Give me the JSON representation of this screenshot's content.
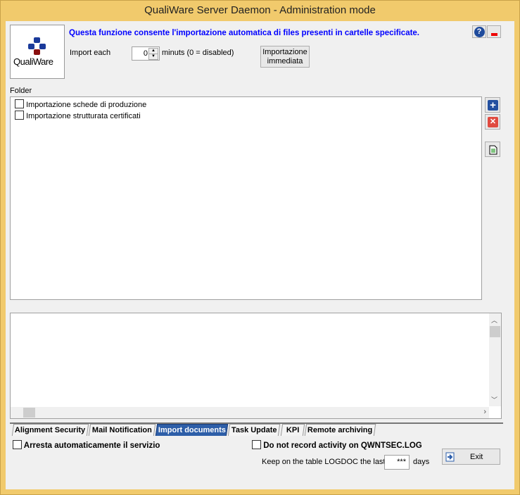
{
  "window": {
    "title": "QualiWare Server Daemon - Administration mode",
    "border_color": "#f0c86a"
  },
  "header": {
    "logo_text": "QualiWare",
    "description": "Questa funzione consente l'importazione automatica di files presenti in cartelle specificate.",
    "description_color": "#0000ff",
    "help_icon": "help-icon",
    "minimize_icon": "minimize-icon"
  },
  "import": {
    "label": "Import each",
    "value": "0",
    "unit_label": "minuts (0 = disabled)",
    "now_button_line1": "Importazione",
    "now_button_line2": "immediata"
  },
  "folder": {
    "label": "Folder",
    "items": [
      {
        "label": "Importazione schede di produzione",
        "checked": false
      },
      {
        "label": "Importazione strutturata certificati",
        "checked": false
      }
    ]
  },
  "side_buttons": {
    "add": "plus-icon",
    "remove": "close-icon",
    "details": "document-icon"
  },
  "tabs": [
    {
      "label": "Alignment Security"
    },
    {
      "label": "Mail Notification"
    },
    {
      "label": "Import documents",
      "selected": true
    },
    {
      "label": "Task Update"
    },
    {
      "label": "KPI"
    },
    {
      "label": "Remote archiving"
    }
  ],
  "footer": {
    "auto_stop_label": "Arresta automaticamente il servizio",
    "no_record_label": "Do not record activity on QWNTSEC.LOG",
    "keep_label": "Keep on the table LOGDOC the last",
    "keep_value": "***",
    "days_label": "days",
    "exit_label": "Exit"
  }
}
